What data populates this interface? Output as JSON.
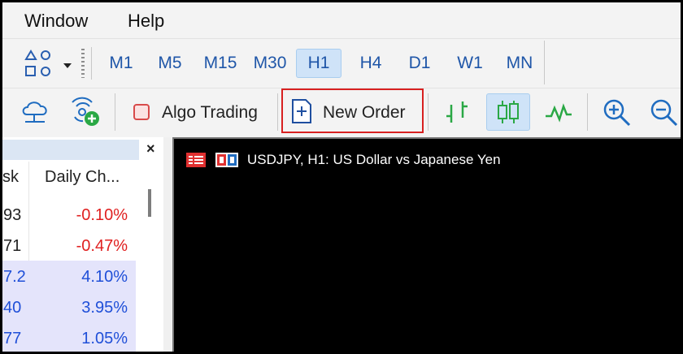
{
  "menu": {
    "items": [
      "Window",
      "Help"
    ]
  },
  "timeframes": {
    "items": [
      {
        "label": "M1",
        "active": false
      },
      {
        "label": "M5",
        "active": false
      },
      {
        "label": "M15",
        "active": false
      },
      {
        "label": "M30",
        "active": false
      },
      {
        "label": "H1",
        "active": true
      },
      {
        "label": "H4",
        "active": false
      },
      {
        "label": "D1",
        "active": false
      },
      {
        "label": "W1",
        "active": false
      },
      {
        "label": "MN",
        "active": false
      }
    ]
  },
  "toolbar": {
    "algo_trading_label": "Algo Trading",
    "new_order_label": "New Order"
  },
  "market_watch": {
    "columns": [
      "sk",
      "Daily Ch..."
    ],
    "rows": [
      {
        "ask": "93",
        "change": "-0.10%",
        "positive": false
      },
      {
        "ask": "71",
        "change": "-0.47%",
        "positive": false
      },
      {
        "ask": "7.2",
        "change": "4.10%",
        "positive": true
      },
      {
        "ask": "40",
        "change": "3.95%",
        "positive": true
      },
      {
        "ask": "77",
        "change": "1.05%",
        "positive": true
      }
    ],
    "close_symbol": "×"
  },
  "chart": {
    "title": "USDJPY, H1:  US Dollar vs Japanese Yen"
  },
  "colors": {
    "accent": "#1f56a8",
    "negative": "#e02020",
    "positive": "#1f4fd8",
    "highlight": "#d82020"
  }
}
